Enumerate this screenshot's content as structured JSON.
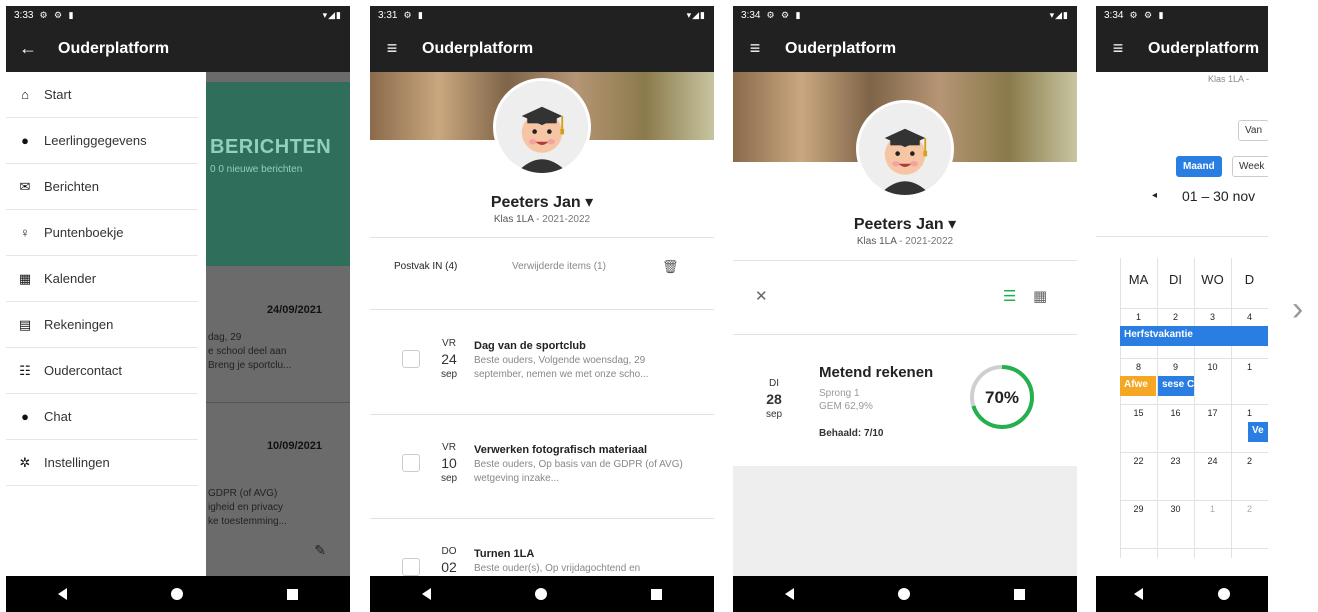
{
  "screens": {
    "s1": {
      "time": "3:33",
      "title": "Ouderplatform",
      "menu": [
        {
          "icon": "home-icon",
          "glyph": "⌂",
          "label": "Start"
        },
        {
          "icon": "person-icon",
          "glyph": "●",
          "label": "Leerlinggegevens"
        },
        {
          "icon": "mail-icon",
          "glyph": "✉",
          "label": "Berichten"
        },
        {
          "icon": "ribbon-icon",
          "glyph": "♀",
          "label": "Puntenboekje"
        },
        {
          "icon": "calendar-icon",
          "glyph": "▦",
          "label": "Kalender"
        },
        {
          "icon": "invoice-icon",
          "glyph": "▤",
          "label": "Rekeningen"
        },
        {
          "icon": "people-icon",
          "glyph": "☷",
          "label": "Oudercontact"
        },
        {
          "icon": "chat-icon",
          "glyph": "●",
          "label": "Chat"
        },
        {
          "icon": "gear-icon",
          "glyph": "✲",
          "label": "Instellingen"
        }
      ],
      "bg_title": "BERICHTEN",
      "bg_sub": "0 0 nieuwe berichten",
      "bg_date1": "24/09/2021",
      "bg_lines1": [
        "dag, 29",
        "e school deel aan",
        "Breng je sportclu..."
      ],
      "bg_date2": "10/09/2021",
      "bg_lines2": [
        "GDPR (of AVG)",
        "igheid en privacy",
        "ke toestemming..."
      ]
    },
    "s2": {
      "time": "3:31",
      "title": "Ouderplatform",
      "name": "Peeters Jan",
      "klas": "Klas 1LA",
      "year": "2021-2022",
      "tab_in": "Postvak IN (4)",
      "tab_del": "Verwijderde items (1)",
      "messages": [
        {
          "dow": "VR",
          "day": "24",
          "mon": "sep",
          "title": "Dag van de sportclub",
          "body": "Beste ouders,   Volgende woensdag, 29 september, nemen we met onze scho..."
        },
        {
          "dow": "VR",
          "day": "10",
          "mon": "sep",
          "title": "Verwerken fotografisch materiaal",
          "body": "Beste ouders, Op basis van de GDPR (of AVG) wetgeving inzake..."
        },
        {
          "dow": "DO",
          "day": "02",
          "mon": "sep",
          "title": "Turnen 1LA",
          "body": "Beste ouder(s), Op vrijdagochtend en"
        }
      ]
    },
    "s3": {
      "time": "3:34",
      "title": "Ouderplatform",
      "name": "Peeters Jan",
      "klas": "Klas 1LA",
      "year": "2021-2022",
      "dow": "DI",
      "day": "28",
      "mon": "sep",
      "subject": "Metend rekenen",
      "sub1": "Sprong 1",
      "sub2": "GEM 62,9%",
      "score": "Behaald: 7/10",
      "percent_label": "70%",
      "percent": 0.7
    },
    "s4": {
      "time": "3:34",
      "title": "Ouderplatform",
      "top_text": "Klas 1LA -",
      "btn_van": "Van",
      "btn_maand": "Maand",
      "btn_week": "Week",
      "range": "01 – 30 nov",
      "headers": [
        "MA",
        "DI",
        "WO",
        "D"
      ],
      "rows": [
        [
          "1",
          "2",
          "3",
          "4"
        ],
        [
          "8",
          "9",
          "10",
          "1"
        ],
        [
          "15",
          "16",
          "17",
          "1"
        ],
        [
          "22",
          "23",
          "24",
          "2"
        ],
        [
          "29",
          "30",
          "1",
          "2"
        ]
      ],
      "ev1": "Herfstvakantie",
      "ev2": "Afwe",
      "ev3": "sese C",
      "ev4": "Ve"
    }
  },
  "colors": {
    "accent": "#2a7de1",
    "success": "#22b14c",
    "warning": "#f5a623",
    "dark": "#212121"
  }
}
